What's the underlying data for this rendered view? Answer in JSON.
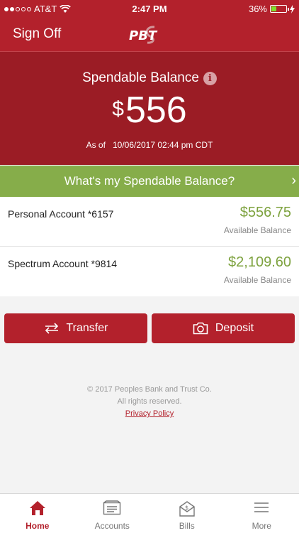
{
  "status_bar": {
    "carrier": "AT&T",
    "time": "2:47 PM",
    "battery": "36%",
    "battery_level": 0.36
  },
  "nav": {
    "sign_off": "Sign Off",
    "logo": "PBT"
  },
  "balance": {
    "title": "Spendable Balance",
    "currency": "$",
    "amount": "556",
    "as_of_label": "As of",
    "as_of_value": "10/06/2017 02:44 pm CDT"
  },
  "banner": {
    "label": "What's my Spendable Balance?"
  },
  "accounts": [
    {
      "name": "Personal Account *6157",
      "amount": "$556.75",
      "sub": "Available Balance"
    },
    {
      "name": "Spectrum Account *9814",
      "amount": "$2,109.60",
      "sub": "Available Balance"
    }
  ],
  "actions": {
    "transfer": "Transfer",
    "deposit": "Deposit"
  },
  "footer": {
    "copyright": "© 2017 Peoples Bank and Trust Co.",
    "rights": "All rights reserved.",
    "privacy": "Privacy Policy"
  },
  "tabs": [
    {
      "label": "Home",
      "icon": "home-icon",
      "active": true
    },
    {
      "label": "Accounts",
      "icon": "accounts-icon",
      "active": false
    },
    {
      "label": "Bills",
      "icon": "bills-icon",
      "active": false
    },
    {
      "label": "More",
      "icon": "menu-icon",
      "active": false
    }
  ],
  "colors": {
    "brand_red": "#b3212c",
    "panel_red": "#9b1c25",
    "banner_green": "#86ad4a",
    "amount_green": "#7da23e"
  }
}
